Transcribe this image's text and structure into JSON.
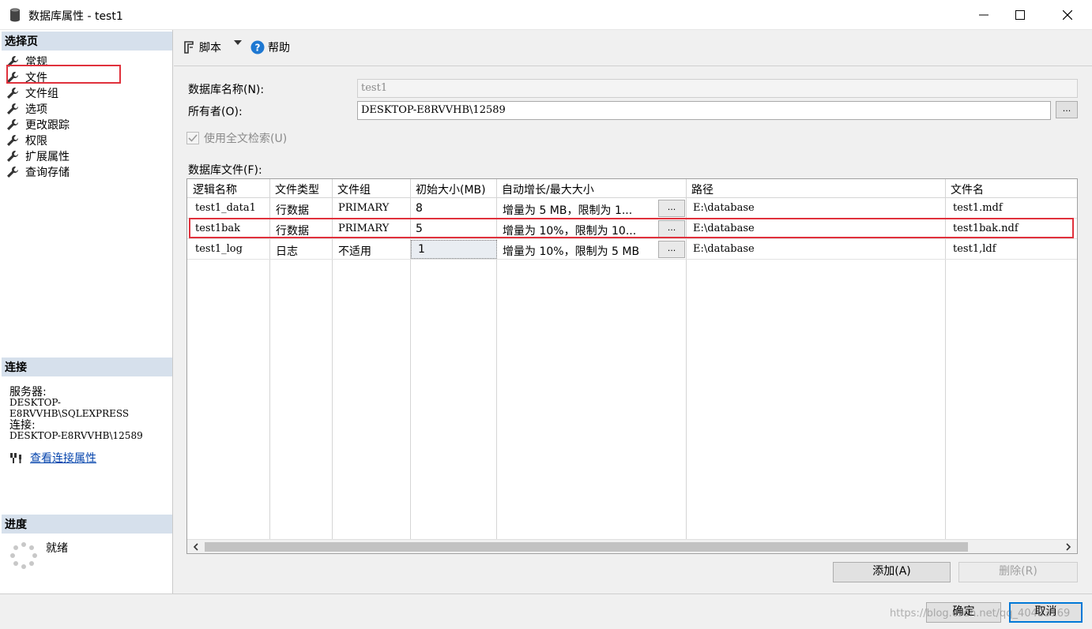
{
  "window": {
    "title": "数据库属性 - test1"
  },
  "sidebar": {
    "select_page_header": "选择页",
    "items": [
      {
        "label": "常规"
      },
      {
        "label": "文件"
      },
      {
        "label": "文件组"
      },
      {
        "label": "选项"
      },
      {
        "label": "更改跟踪"
      },
      {
        "label": "权限"
      },
      {
        "label": "扩展属性"
      },
      {
        "label": "查询存储"
      }
    ],
    "connection_header": "连接",
    "server_label": "服务器:",
    "server_value": "DESKTOP-E8RVVHB\\SQLEXPRESS",
    "connection_label": "连接:",
    "connection_value": "DESKTOP-E8RVVHB\\12589",
    "view_connection_link": "查看连接属性",
    "progress_header": "进度",
    "progress_status": "就绪"
  },
  "toolbar": {
    "script_label": "脚本",
    "help_label": "帮助"
  },
  "form": {
    "db_name_label": "数据库名称(N):",
    "db_name_value": "test1",
    "owner_label": "所有者(O):",
    "owner_value": "DESKTOP-E8RVVHB\\12589",
    "browse_label": "...",
    "fulltext_label": "使用全文检索(U)",
    "files_label": "数据库文件(F):"
  },
  "grid": {
    "columns": [
      "逻辑名称",
      "文件类型",
      "文件组",
      "初始大小(MB)",
      "自动增长/最大大小",
      "路径",
      "文件名"
    ],
    "rows": [
      {
        "logical": "test1_data1",
        "type": "行数据",
        "group": "PRIMARY",
        "size": "8",
        "growth": "增量为 5 MB，限制为 1...",
        "path": "E:\\database",
        "file": "test1.mdf"
      },
      {
        "logical": "test1bak",
        "type": "行数据",
        "group": "PRIMARY",
        "size": "5",
        "growth": "增量为 10%，限制为 10...",
        "path": "E:\\database",
        "file": "test1bak.ndf"
      },
      {
        "logical": "test1_log",
        "type": "日志",
        "group": "不适用",
        "size": "1",
        "growth": "增量为 10%，限制为 5 MB",
        "path": "E:\\database",
        "file": "test1,ldf"
      }
    ],
    "cell_button": "..."
  },
  "buttons": {
    "add": "添加(A)",
    "remove": "删除(R)",
    "ok": "确定",
    "cancel": "取消"
  },
  "watermark": "https://blog.csdn.net/qq_40483169",
  "colors": {
    "highlight": "#e0313c",
    "header_bg": "#d6e0ec",
    "link": "#0645ad"
  }
}
